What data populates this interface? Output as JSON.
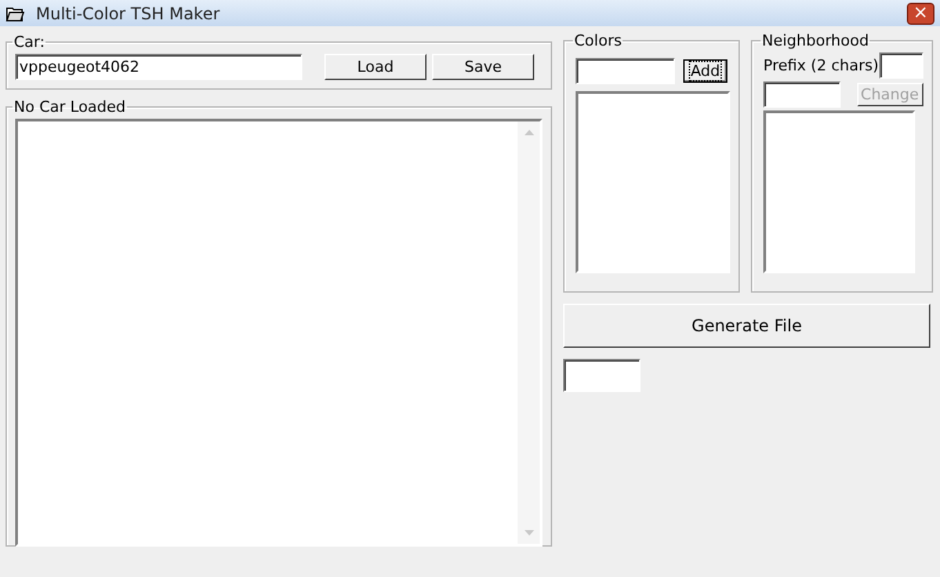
{
  "window": {
    "title": "Multi-Color TSH Maker",
    "close": "×"
  },
  "car": {
    "label": "Car:",
    "value": "vppeugeot4062",
    "buttons": [
      {
        "label": "Load",
        "focused": false
      },
      {
        "label": "Save",
        "focused": false
      }
    ]
  },
  "car_panel": {
    "label": "No Car Loaded"
  },
  "colors": {
    "label": "Colors",
    "add": {
      "label": "Add",
      "focused": true
    }
  },
  "neighborhood": {
    "label": "Neighborhood",
    "prefix_label": "Prefix (2 chars)",
    "change": {
      "label": "Change",
      "disabled": true
    }
  },
  "generate": {
    "label": "Generate File"
  }
}
